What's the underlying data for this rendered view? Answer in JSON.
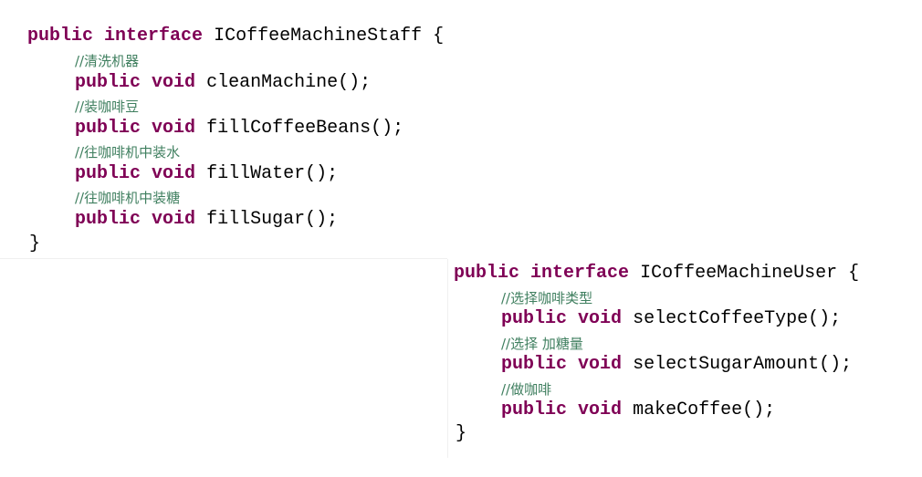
{
  "staff_interface": {
    "kw_public": "public",
    "kw_interface": "interface",
    "name": "ICoffeeMachineStaff",
    "open_brace": "{",
    "close_brace": "}",
    "methods": [
      {
        "comment": "//清洗机器",
        "kw_public": "public",
        "kw_void": "void",
        "signature": "cleanMachine();"
      },
      {
        "comment": "//装咖啡豆",
        "kw_public": "public",
        "kw_void": "void",
        "signature": "fillCoffeeBeans();"
      },
      {
        "comment": "//往咖啡机中装水",
        "kw_public": "public",
        "kw_void": "void",
        "signature": "fillWater();"
      },
      {
        "comment": "//往咖啡机中装糖",
        "kw_public": "public",
        "kw_void": "void",
        "signature": "fillSugar();"
      }
    ]
  },
  "user_interface": {
    "kw_public": "public",
    "kw_interface": "interface",
    "name": "ICoffeeMachineUser",
    "open_brace": "{",
    "close_brace": "}",
    "methods": [
      {
        "comment": "//选择咖啡类型",
        "kw_public": "public",
        "kw_void": "void",
        "signature": "selectCoffeeType();"
      },
      {
        "comment": "//选择 加糖量",
        "kw_public": "public",
        "kw_void": "void",
        "signature": "selectSugarAmount();"
      },
      {
        "comment": "//做咖啡",
        "kw_public": "public",
        "kw_void": "void",
        "signature": "makeCoffee();"
      }
    ]
  },
  "colors": {
    "keyword": "#7f0055",
    "comment": "#3f7f5f",
    "text": "#000000",
    "background": "#ffffff"
  }
}
